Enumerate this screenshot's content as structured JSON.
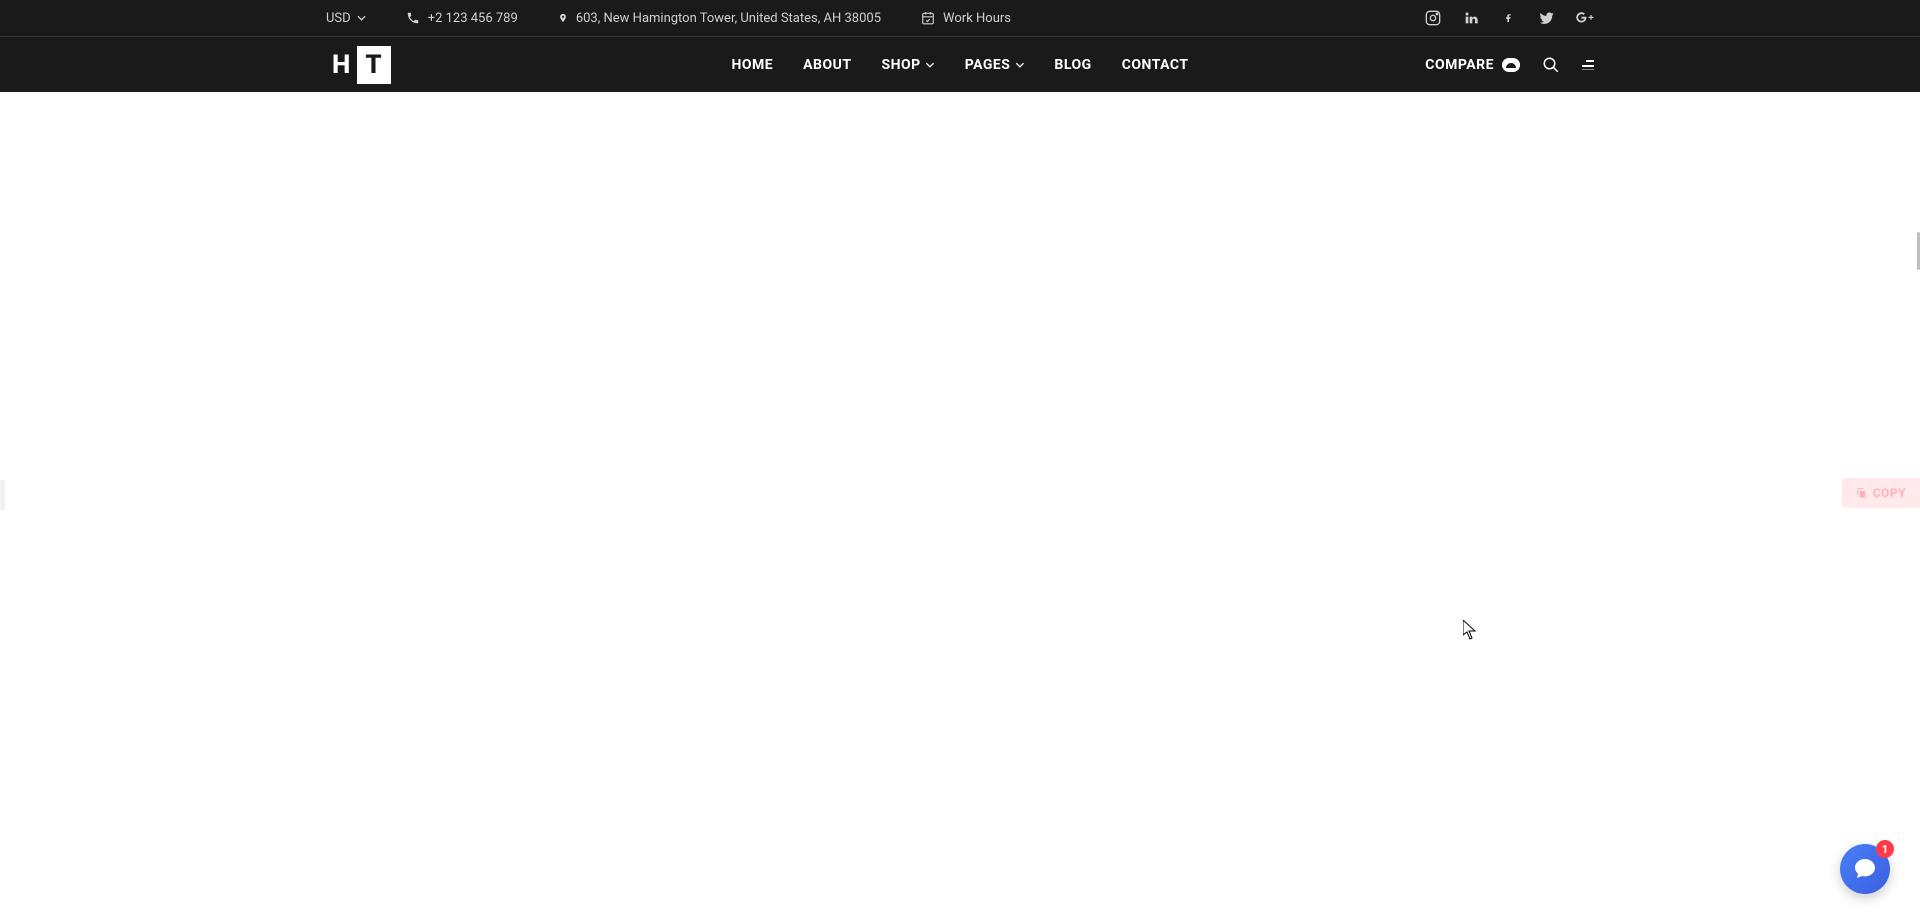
{
  "topbar": {
    "currency": "USD",
    "phone": "+2 123 456 789",
    "address": "603, New Hamington Tower, United States, AH 38005",
    "work_hours": "Work Hours"
  },
  "nav": {
    "items": [
      {
        "label": "HOME"
      },
      {
        "label": "ABOUT"
      },
      {
        "label": "SHOP",
        "has_dropdown": true
      },
      {
        "label": "PAGES",
        "has_dropdown": true
      },
      {
        "label": "BLOG"
      },
      {
        "label": "CONTACT"
      }
    ],
    "compare_label": "COMPARE"
  },
  "logo": {
    "left": "H",
    "right": "T"
  },
  "copy_button": {
    "label": "COPY"
  },
  "chat": {
    "badge_count": "1"
  }
}
